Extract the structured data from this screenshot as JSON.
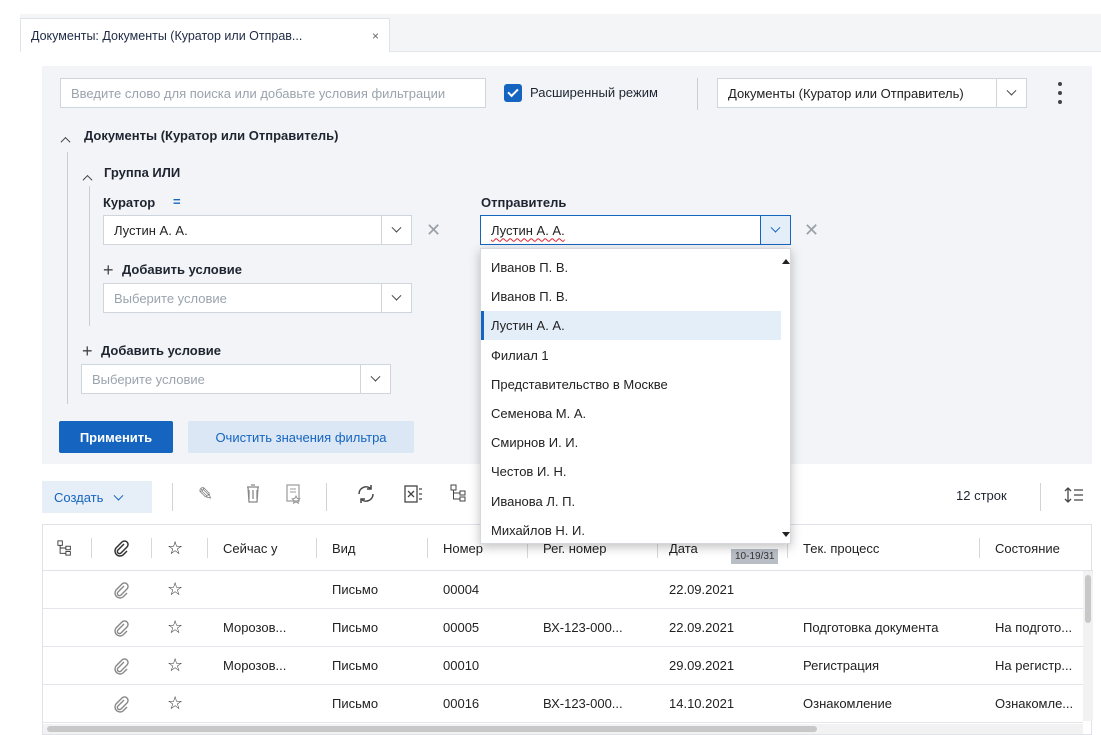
{
  "tab": {
    "title": "Документы: Документы (Куратор или Отправ...",
    "close": "×"
  },
  "search": {
    "placeholder": "Введите слово для поиска или добавьте условия фильтрации"
  },
  "extended_mode": {
    "label": "Расширенный режим",
    "checked": true
  },
  "preset": {
    "value": "Документы (Куратор или Отправитель)"
  },
  "filter": {
    "root_label": "Документы (Куратор или Отправитель)",
    "group_label": "Группа ИЛИ",
    "curator": {
      "label": "Куратор",
      "op": "=",
      "value": "Лустин А. А."
    },
    "sender": {
      "label": "Отправитель",
      "value": "Лустин А. А."
    },
    "add_condition_inner": "Добавить условие",
    "add_condition_outer": "Добавить условие",
    "select_placeholder": "Выберите условие",
    "apply": "Применить",
    "clear": "Очистить значения фильтра"
  },
  "dropdown": {
    "items": [
      "Иванов П. В.",
      "Иванов П. В.",
      "Лустин А. А.",
      "Филиал 1",
      "Представительство в Москве",
      "Семенова М. А.",
      "Смирнов И. И.",
      "Честов И. Н.",
      "Иванова Л. П.",
      "Михайлов Н. И."
    ],
    "selected_index": 2
  },
  "toolbar": {
    "create": "Создать",
    "rows_count": "12 строк"
  },
  "grid": {
    "columns": [
      "Сейчас у",
      "Вид",
      "Номер",
      "Рег. номер",
      "Дата",
      "Тек. процесс",
      "Состояние"
    ],
    "date_tooltip": "10-19/31",
    "rows": [
      {
        "now_at": "",
        "kind": "Письмо",
        "number": "00004",
        "reg": "",
        "date": "22.09.2021",
        "process": "",
        "state": ""
      },
      {
        "now_at": "Морозов...",
        "kind": "Письмо",
        "number": "00005",
        "reg": "ВХ-123-000...",
        "date": "22.09.2021",
        "process": "Подготовка документа",
        "state": "На подгото..."
      },
      {
        "now_at": "Морозов...",
        "kind": "Письмо",
        "number": "00010",
        "reg": "",
        "date": "29.09.2021",
        "process": "Регистрация",
        "state": "На регистр..."
      },
      {
        "now_at": "",
        "kind": "Письмо",
        "number": "00016",
        "reg": "ВХ-123-000...",
        "date": "14.10.2021",
        "process": "Ознакомление",
        "state": "Ознакомле..."
      }
    ]
  },
  "icons": {
    "tree": "tree-icon",
    "attach": "paperclip-icon",
    "star": "star-icon",
    "edit": "pencil-icon",
    "delete": "trash-icon",
    "favorite": "favorite-doc-icon",
    "refresh": "refresh-icon",
    "excel": "excel-icon",
    "more": "kebab-icon",
    "density": "row-density-icon"
  },
  "colors": {
    "accent": "#1565c0",
    "panel": "#f2f4f7",
    "selected_bg": "#e4eef9"
  }
}
